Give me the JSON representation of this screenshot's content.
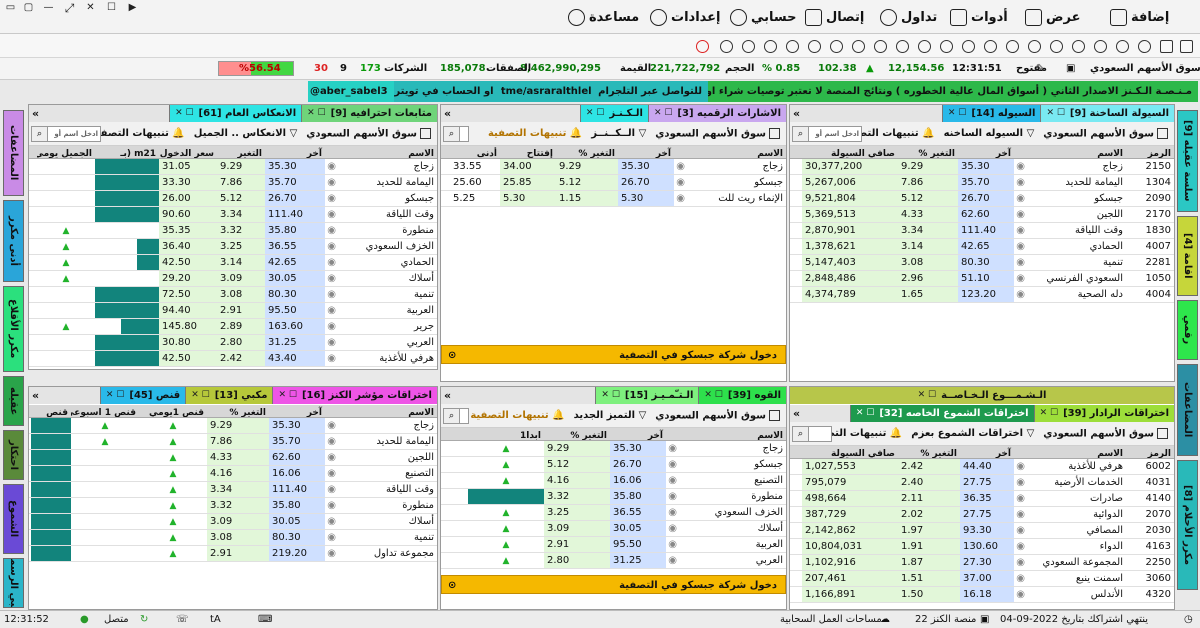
{
  "window": {
    "controls": [
      "☐",
      "▭",
      "✕",
      "↕",
      "—",
      "▢"
    ]
  },
  "menu": {
    "items": [
      "إضافة",
      "عرض",
      "أدوات",
      "تداول",
      "إتصال",
      "حسابي",
      "إعدادات",
      "مساعدة"
    ]
  },
  "ticker": {
    "market": "سوق الأسهم السعودي",
    "state": "مفتوح",
    "time": "12:31:51",
    "index": "12,154.56",
    "change": "102.38",
    "pct": "0.85 %",
    "vol_label": "الحجم",
    "vol": "221,722,792",
    "val_label": "القيمة",
    "val": "8,462,990,295",
    "deals_label": "الصفقات",
    "deals": "185,078",
    "companies_label": "الشركات",
    "up": "173",
    "unch": "9",
    "down": "30",
    "ratio": "%56.54",
    "ratio_fraction": 0.5654
  },
  "banner": {
    "a": "مـنـصـة الـكـنز الاصدار الثاني ( أسواق المال عالية الخطوره ) ونتائج المنصة لا تعتبر توصيات شراء او بيع",
    "b": "للتواصل عبر التلجرام",
    "c": "tme/asraralthlel",
    "d": "او الحساب في تويتر",
    "e": "aber_sabel3@"
  },
  "common": {
    "market": "سوق الأسهم السعودي",
    "alerts": "تنبيهات التصفية",
    "search": "ادخل اسم أو",
    "empty": ""
  },
  "sidetabs_right": [
    "سلسة عقيله [9]",
    "اقامة [4]",
    "رقمي",
    "المضاعفات",
    "مكرر الأحلام [8]"
  ],
  "sidetabs_left": [
    "المضاعفات",
    "أدنى مكرر",
    "مكرر الأقلاع",
    "عقيله",
    "احتكار",
    "الشموع",
    "أمبي الرسمي"
  ],
  "p1": {
    "tabs": [
      "السيولة الساخنة [9]",
      "السيوله [14]"
    ],
    "filter": "السيوله الساخنه",
    "cols": [
      "الرمز",
      "الاسم",
      "آخر",
      "التغير %",
      "صافي السيولة"
    ],
    "rows": [
      [
        "2150",
        "زجاج",
        "35.30",
        "9.29",
        "30,377,200"
      ],
      [
        "1304",
        "اليمامة للحديد",
        "35.70",
        "7.86",
        "5,267,006"
      ],
      [
        "2090",
        "جبسكو",
        "26.70",
        "5.12",
        "9,521,804"
      ],
      [
        "2170",
        "اللجين",
        "62.60",
        "4.33",
        "5,369,513"
      ],
      [
        "1830",
        "وقت اللياقة",
        "111.40",
        "3.34",
        "2,870,901"
      ],
      [
        "4007",
        "الحمادي",
        "42.65",
        "3.14",
        "1,378,621"
      ],
      [
        "2281",
        "تنمية",
        "80.30",
        "3.08",
        "5,147,403"
      ],
      [
        "1050",
        "السعودي الفرنسي",
        "51.10",
        "2.96",
        "2,848,486"
      ],
      [
        "4004",
        "دله الصحية",
        "123.20",
        "1.65",
        "4,374,789"
      ]
    ]
  },
  "p2": {
    "tabs": [
      "الاشارات الرقميه [3]",
      "الـكـنـز"
    ],
    "filter": "الــكــنــز",
    "cols": [
      "الاسم",
      "آخر",
      "التغير %",
      "إفتتاح",
      "أدنى"
    ],
    "rows": [
      [
        "زجاج",
        "35.30",
        "9.29",
        "34.00",
        "33.55"
      ],
      [
        "جبسكو",
        "26.70",
        "5.12",
        "25.85",
        "25.60"
      ],
      [
        "الإنماء ريت للت",
        "5.30",
        "1.15",
        "5.30",
        "5.25"
      ]
    ],
    "note": "دخول شركة جبسكو في التصفية"
  },
  "p3": {
    "tabs": [
      "متابعات احترافيه [9]",
      "الانعكاس العام [61]"
    ],
    "filter": "الانعكاس .. الجميل",
    "cols": [
      "الاسم",
      "آخر",
      "التغير",
      "سعر الدخول",
      "m21 (بـ",
      "الجميل يومي (يوم"
    ],
    "rows": [
      [
        "زجاج",
        "35.30",
        "9.29",
        "31.05",
        1,
        0
      ],
      [
        "اليمامة للحديد",
        "35.70",
        "7.86",
        "33.30",
        1,
        0
      ],
      [
        "جبسكو",
        "26.70",
        "5.12",
        "26.00",
        1,
        0
      ],
      [
        "وقت اللياقة",
        "111.40",
        "3.34",
        "90.60",
        1,
        0
      ],
      [
        "منطورة",
        "35.80",
        "3.32",
        "35.35",
        0,
        1
      ],
      [
        "الخزف السعودي",
        "36.55",
        "3.25",
        "36.40",
        0.35,
        1
      ],
      [
        "الحمادي",
        "42.65",
        "3.14",
        "42.50",
        0.35,
        1
      ],
      [
        "أسلاك",
        "30.05",
        "3.09",
        "29.20",
        0,
        1
      ],
      [
        "تنمية",
        "80.30",
        "3.08",
        "72.50",
        1,
        0
      ],
      [
        "العربية",
        "95.50",
        "2.91",
        "94.40",
        1,
        0
      ],
      [
        "جرير",
        "163.60",
        "2.89",
        "145.80",
        0.6,
        1
      ],
      [
        "العربي",
        "31.25",
        "2.80",
        "30.80",
        1,
        0
      ],
      [
        "هرفي للأغذية",
        "43.40",
        "2.42",
        "42.50",
        1,
        0
      ]
    ]
  },
  "p4": {
    "tabs": [
      "اختراقات مؤشر الكنز [16]",
      "مكبي [13]",
      "قنص [45]"
    ],
    "filter": "",
    "cols": [
      "الاسم",
      "آخر",
      "التغير %",
      "قنص 1يومي",
      "قنص 1 اسبوعي",
      "قنص"
    ],
    "rows": [
      [
        "زجاج",
        "35.30",
        "9.29",
        1,
        1
      ],
      [
        "اليمامة للحديد",
        "35.70",
        "7.86",
        1,
        1
      ],
      [
        "اللجين",
        "62.60",
        "4.33",
        1,
        0
      ],
      [
        "التصنيع",
        "16.06",
        "4.16",
        1,
        0
      ],
      [
        "وقت اللياقة",
        "111.40",
        "3.34",
        1,
        0
      ],
      [
        "منطورة",
        "35.80",
        "3.32",
        1,
        0
      ],
      [
        "أسلاك",
        "30.05",
        "3.09",
        1,
        0
      ],
      [
        "تنمية",
        "80.30",
        "3.08",
        1,
        0
      ],
      [
        "مجموعة تداول",
        "219.20",
        "2.91",
        1,
        0
      ]
    ]
  },
  "p5": {
    "tabs": [
      "القوه [39]",
      "الـتـّمـيـز [15]"
    ],
    "filter": "التميز الجديد",
    "cols": [
      "الاسم",
      "آخر",
      "التغير %",
      "ابدا1"
    ],
    "rows": [
      [
        "زجاج",
        "35.30",
        "9.29",
        0
      ],
      [
        "جبسكو",
        "26.70",
        "5.12",
        0
      ],
      [
        "التصنيع",
        "16.06",
        "4.16",
        0
      ],
      [
        "منطورة",
        "35.80",
        "3.32",
        1
      ],
      [
        "الخزف السعودي",
        "36.55",
        "3.25",
        0
      ],
      [
        "أسلاك",
        "30.05",
        "3.09",
        0
      ],
      [
        "العربية",
        "95.50",
        "2.91",
        0
      ],
      [
        "العربي",
        "31.25",
        "2.80",
        0
      ]
    ],
    "note": "دخول شركة جبسكو في التصفية"
  },
  "p6": {
    "tabs": [
      "الـشـمـــوع الـخـاصــة",
      "اختراقات الرادار [39]",
      "اختراقات الشموع الخاصه [32]"
    ],
    "filter": "اختراقات الشموع بعزم",
    "cols": [
      "الرمز",
      "الاسم",
      "آخر",
      "التغير %",
      "صافي السيولة"
    ],
    "rows": [
      [
        "6002",
        "هرفي للأغذية",
        "44.40",
        "2.42",
        "1,027,553"
      ],
      [
        "4031",
        "الخدمات الأرضية",
        "27.75",
        "2.40",
        "795,079"
      ],
      [
        "4140",
        "صادرات",
        "36.35",
        "2.11",
        "498,664"
      ],
      [
        "2070",
        "الدوائية",
        "27.75",
        "2.02",
        "387,729"
      ],
      [
        "2030",
        "المصافي",
        "93.30",
        "1.97",
        "2,142,862"
      ],
      [
        "4163",
        "الدواء",
        "130.60",
        "1.91",
        "10,804,031"
      ],
      [
        "2250",
        "المجموعة السعودي",
        "27.30",
        "1.87",
        "1,102,916"
      ],
      [
        "3060",
        "اسمنت ينبع",
        "37.00",
        "1.51",
        "207,461"
      ],
      [
        "4320",
        "الأندلس",
        "16.18",
        "1.50",
        "1,166,891"
      ]
    ]
  },
  "status": {
    "time": "12:31:52",
    "connected": "متصل",
    "workspace": "مساحات العمل السحابية",
    "platform": "منصة الكنز 22",
    "expiry": "ينتهي اشتراكك بتاريخ 2022-09-04"
  }
}
